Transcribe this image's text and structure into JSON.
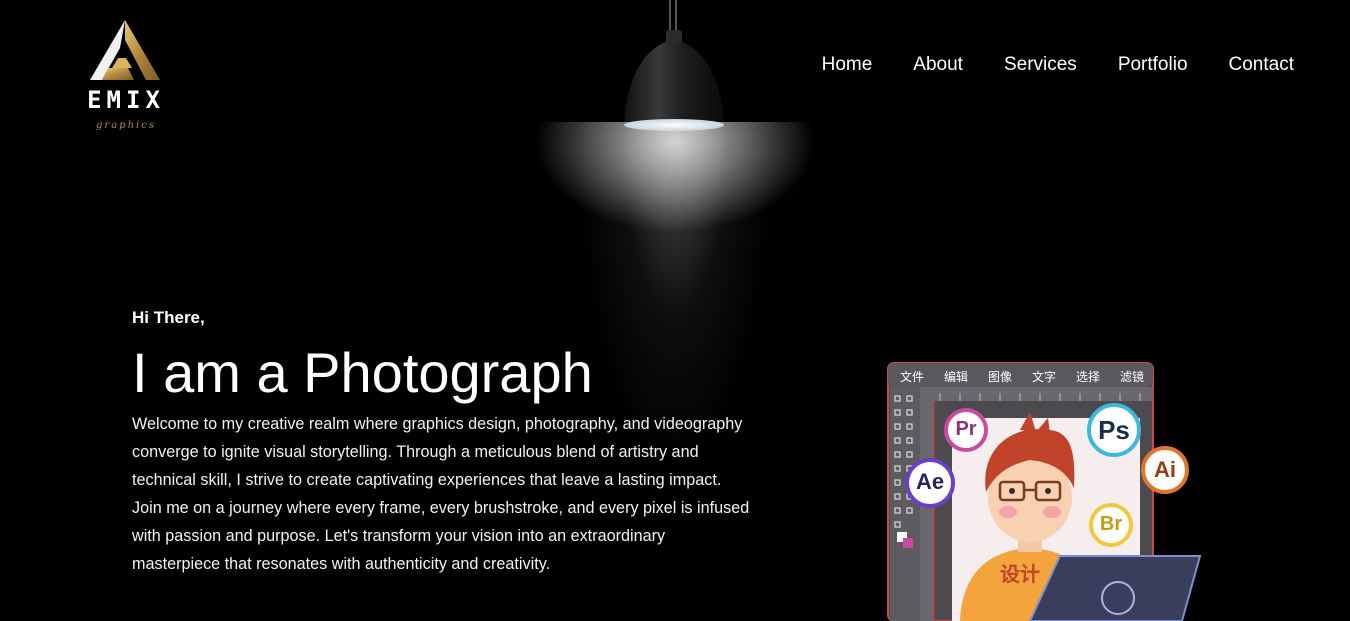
{
  "logo": {
    "word": "EMIX",
    "tagline": "graphics"
  },
  "nav": {
    "items": [
      "Home",
      "About",
      "Services",
      "Portfolio",
      "Contact"
    ]
  },
  "hero": {
    "greeting": "Hi There,",
    "title": "I am a Photograph",
    "description": "Welcome to my creative realm where graphics design, photography, and videography converge to ignite visual storytelling. Through a meticulous blend of artistry and technical skill, I strive to create captivating experiences that leave a lasting impact. Join me on a journey where every frame, every brushstroke, and every pixel is infused with passion and purpose. Let's transform your vision into an extraordinary masterpiece that resonates with authenticity and creativity."
  },
  "illustration": {
    "menu": [
      "文件",
      "编辑",
      "图像",
      "文字",
      "选择",
      "滤镜"
    ],
    "badges": {
      "pr": "Pr",
      "ps": "Ps",
      "ae": "Ae",
      "ai": "Ai",
      "br": "Br"
    },
    "shirt_text": "设计"
  },
  "colors": {
    "background": "#000000",
    "logo_gold": "#b0863e",
    "text": "#ffffff"
  }
}
